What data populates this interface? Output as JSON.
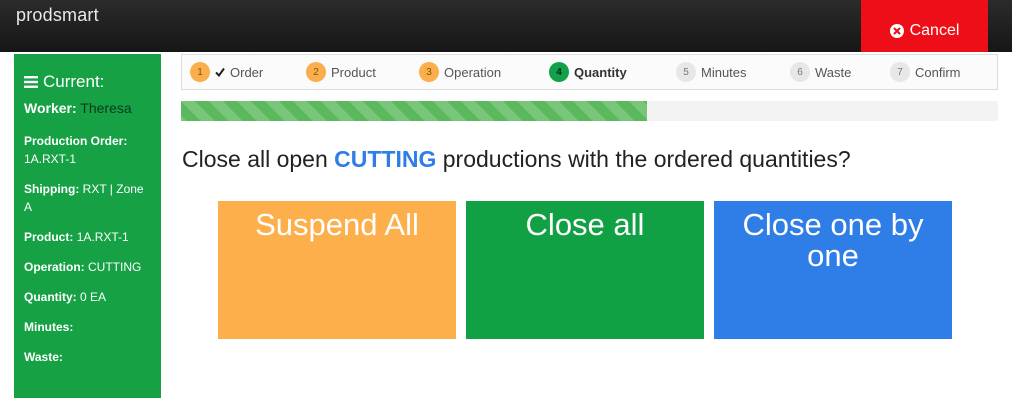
{
  "app": {
    "brand": "prodsmart"
  },
  "header": {
    "cancel_label": "Cancel",
    "cancel_icon": "times-circle-icon"
  },
  "sidebar": {
    "title": "Current:",
    "worker_label": "Worker:",
    "worker_value": "Theresa",
    "fields": [
      {
        "label": "Production Order:",
        "value": "1A.RXT-1"
      },
      {
        "label": "Shipping:",
        "value": "RXT | Zone A"
      },
      {
        "label": "Product:",
        "value": "1A.RXT-1"
      },
      {
        "label": "Operation:",
        "value": "CUTTING"
      },
      {
        "label": "Quantity:",
        "value": "0 EA"
      },
      {
        "label": "Minutes:",
        "value": ""
      },
      {
        "label": "Waste:",
        "value": ""
      }
    ]
  },
  "steps": [
    {
      "num": "1",
      "label": "Order",
      "state": "done",
      "checked": true
    },
    {
      "num": "2",
      "label": "Product",
      "state": "done"
    },
    {
      "num": "3",
      "label": "Operation",
      "state": "done"
    },
    {
      "num": "4",
      "label": "Quantity",
      "state": "active"
    },
    {
      "num": "5",
      "label": "Minutes",
      "state": "todo"
    },
    {
      "num": "6",
      "label": "Waste",
      "state": "todo"
    },
    {
      "num": "7",
      "label": "Confirm",
      "state": "todo"
    }
  ],
  "progress": {
    "fraction": 0.57
  },
  "question": {
    "prefix": "Close all open ",
    "keyword": "CUTTING",
    "suffix": " productions with the ordered quantities?"
  },
  "choices": {
    "suspend_all": "Suspend All",
    "close_all": "Close all",
    "close_one_by_one": "Close one by one"
  },
  "colors": {
    "accent_green": "#15a144",
    "cancel_red": "#ee0e17",
    "suspend_orange": "#fdaf4b",
    "close_green": "#12a045",
    "one_by_one_blue": "#2f7de6"
  }
}
